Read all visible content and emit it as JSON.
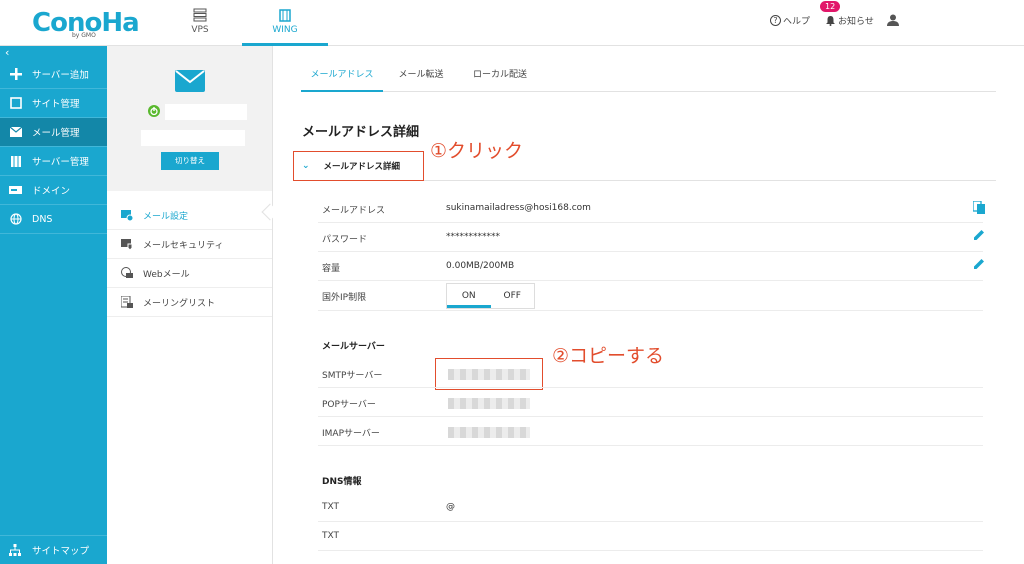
{
  "header": {
    "logo": "ConoHa",
    "logo_sub": "by GMO",
    "tabs": [
      {
        "label": "VPS"
      },
      {
        "label": "WING"
      }
    ],
    "help": "ヘルプ",
    "notifications": "お知らせ",
    "notification_count": "12"
  },
  "sidebar": {
    "collapse": "‹",
    "items": [
      {
        "label": "サーバー追加"
      },
      {
        "label": "サイト管理"
      },
      {
        "label": "メール管理"
      },
      {
        "label": "サーバー管理"
      },
      {
        "label": "ドメイン"
      },
      {
        "label": "DNS"
      }
    ],
    "bottom": "サイトマップ"
  },
  "account_panel": {
    "switch_label": "切り替え",
    "menu": [
      {
        "label": "メール設定"
      },
      {
        "label": "メールセキュリティ"
      },
      {
        "label": "Webメール"
      },
      {
        "label": "メーリングリスト"
      }
    ]
  },
  "main": {
    "tabs": [
      {
        "label": "メールアドレス"
      },
      {
        "label": "メール転送"
      },
      {
        "label": "ローカル配送"
      }
    ],
    "title": "メールアドレス詳細",
    "accordion_label": "メールアドレス詳細",
    "annotation_1": "①クリック",
    "annotation_2": "②コピーする",
    "rows": {
      "email_label": "メールアドレス",
      "email_value": "sukinamailadress@hosi168.com",
      "password_label": "パスワード",
      "password_value": "************",
      "capacity_label": "容量",
      "capacity_value": "0.00MB/200MB",
      "foreign_ip_label": "国外IP制限",
      "toggle_on": "ON",
      "toggle_off": "OFF"
    },
    "mail_server": {
      "heading": "メールサーバー",
      "smtp_label": "SMTPサーバー",
      "pop_label": "POPサーバー",
      "imap_label": "IMAPサーバー"
    },
    "dns": {
      "heading": "DNS情報",
      "txt1_label": "TXT",
      "txt1_value": "@",
      "txt2_label": "TXT"
    }
  },
  "colors": {
    "accent": "#1aa7cf",
    "annotation": "#e24d2d",
    "badge": "#e2176a"
  }
}
